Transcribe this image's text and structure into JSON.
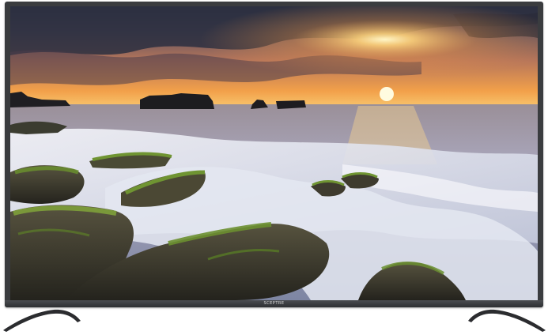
{
  "product": {
    "brand_logo": "SCEPTRE",
    "frame_color": "#3a3c3f",
    "stand_color": "#2b2c2f"
  },
  "scene": {
    "sky_top_color": "#3b3f55",
    "sky_horizon_color": "#f4a24a",
    "sun_color": "#fff4c2",
    "sea_color": "#8c93ad",
    "water_color": "#e9ecf4",
    "rock_color": "#3c3a31",
    "moss_color": "#6a8f2e"
  }
}
